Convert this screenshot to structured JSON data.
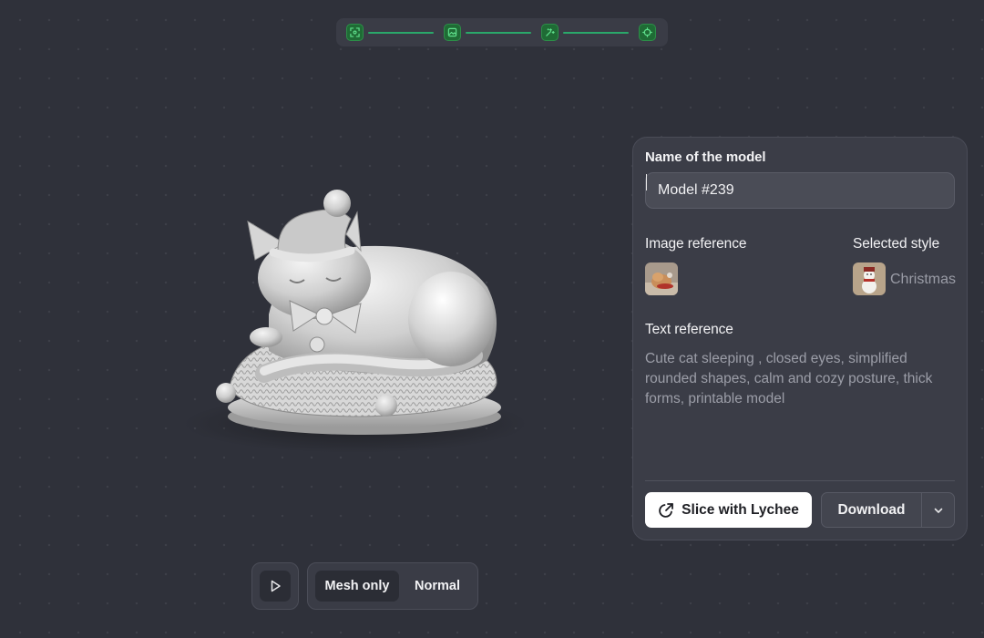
{
  "stepper": {
    "steps": [
      {
        "icon": "scan-icon",
        "status": "completed"
      },
      {
        "icon": "image-icon",
        "status": "completed"
      },
      {
        "icon": "magic-wand-icon",
        "status": "completed"
      },
      {
        "icon": "target-icon",
        "status": "completed"
      }
    ]
  },
  "panel": {
    "name_label": "Name of the model",
    "name_value": "Model #239",
    "image_reference_label": "Image reference",
    "image_reference_icon": "cat-photo-thumbnail",
    "selected_style_label": "Selected style",
    "selected_style_value": "Christmas",
    "selected_style_icon": "snowman-thumbnail",
    "text_reference_label": "Text reference",
    "text_reference_value": "Cute cat sleeping , closed eyes, simplified rounded shapes, calm and cozy posture, thick forms, printable model",
    "slice_button": "Slice with Lychee",
    "download_button": "Download"
  },
  "viewer": {
    "model_subject": "3d-model-sleeping-cat-with-santa-hat",
    "play_icon": "play-icon",
    "view_modes": [
      "Mesh only",
      "Normal"
    ],
    "active_view_mode": "Mesh only"
  },
  "colors": {
    "background": "#2f313a",
    "panel": "#3b3d47",
    "accent_green": "#2aa86a",
    "step_fill": "#1f6b35"
  }
}
